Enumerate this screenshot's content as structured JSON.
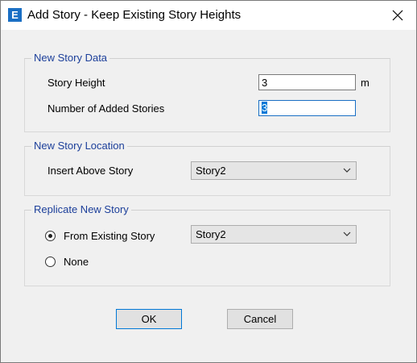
{
  "window": {
    "app_icon_letter": "E",
    "title": "Add Story - Keep Existing Story Heights"
  },
  "new_story_data": {
    "legend": "New Story Data",
    "story_height_label": "Story Height",
    "story_height_value": "3",
    "story_height_unit": "m",
    "added_stories_label": "Number of Added Stories",
    "added_stories_value": "3"
  },
  "new_story_location": {
    "legend": "New Story Location",
    "insert_above_label": "Insert Above Story",
    "insert_above_value": "Story2"
  },
  "replicate_new_story": {
    "legend": "Replicate New Story",
    "from_existing_label": "From Existing Story",
    "from_existing_selected": true,
    "from_existing_value": "Story2",
    "none_label": "None",
    "none_selected": false
  },
  "buttons": {
    "ok": "OK",
    "cancel": "Cancel"
  }
}
